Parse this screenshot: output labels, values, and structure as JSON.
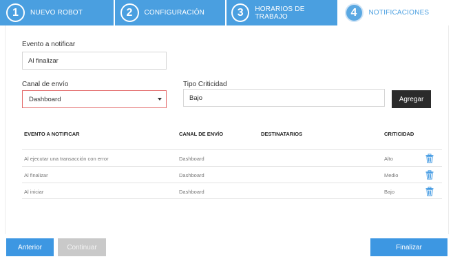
{
  "steps": [
    {
      "number": "1",
      "label": "NUEVO ROBOT"
    },
    {
      "number": "2",
      "label": "CONFIGURACIÓN"
    },
    {
      "number": "3",
      "label": "HORARIOS DE TRABAJO"
    },
    {
      "number": "4",
      "label": "NOTIFICACIONES"
    }
  ],
  "form": {
    "evento_label": "Evento a notificar",
    "evento_value": "Al finalizar",
    "canal_label": "Canal de envío",
    "canal_value": "Dashboard",
    "criticidad_label": "Tipo Criticidad",
    "criticidad_value": "Bajo",
    "agregar_label": "Agregar"
  },
  "table": {
    "headers": [
      "EVENTO A NOTIFICAR",
      "CANAL DE ENVÍO",
      "DESTINATARIOS",
      "CRITICIDAD"
    ],
    "rows": [
      {
        "evento": "Al ejecutar una transacción con error",
        "canal": "Dashboard",
        "destinatarios": "",
        "criticidad": "Alto"
      },
      {
        "evento": "Al finalizar",
        "canal": "Dashboard",
        "destinatarios": "",
        "criticidad": "Medio"
      },
      {
        "evento": "Al iniciar",
        "canal": "Dashboard",
        "destinatarios": "",
        "criticidad": "Bajo"
      }
    ]
  },
  "footer": {
    "anterior": "Anterior",
    "continuar": "Continuar",
    "finalizar": "Finalizar"
  },
  "colors": {
    "accent": "#4a9fe0",
    "button_blue": "#3d97e2",
    "button_dark": "#2b2b2b",
    "button_disabled": "#c9c9c9",
    "error_border": "#e36a6a"
  },
  "icons": {
    "delete": "trash-icon",
    "dropdown": "chevron-down-icon"
  }
}
